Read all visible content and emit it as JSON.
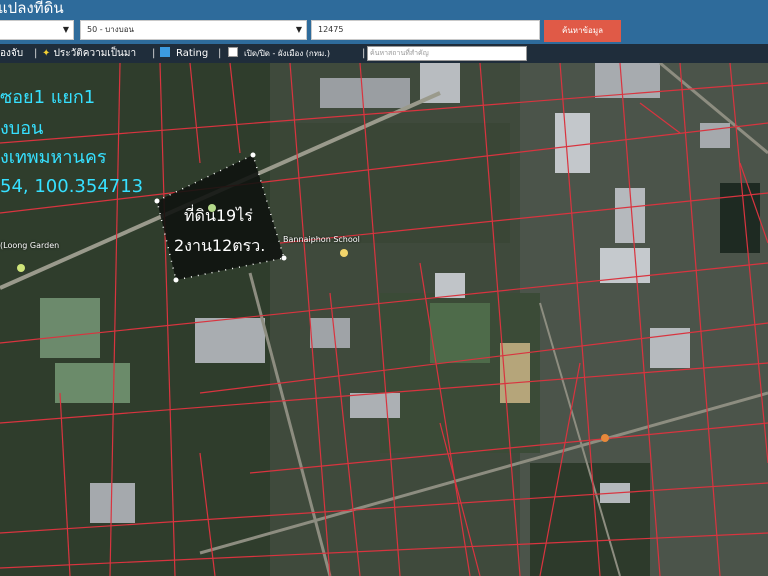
{
  "header": {
    "title": "แปลงที่ดิน",
    "province_value": "",
    "district_value": "50 - บางบอน",
    "parcel_number": "12475",
    "search_button": "ค้นหาข้อมูล"
  },
  "toolbar": {
    "item1": "องจับ",
    "history": "ประวัติความเป็นมา",
    "rating": "Rating",
    "toggle_label": "เปิด/ปิด - ผังเมือง (กทม.)",
    "place_search_placeholder": "ค้นหาสถานที่สำคัญ"
  },
  "overlay": {
    "line1": "ซอย1 แยก1",
    "line2": "งบอน",
    "line3": "งเทพมหานคร",
    "line4": "54, 100.354713"
  },
  "plot": {
    "area_line1": "ที่ดิน19ไร่",
    "area_line2": "2งาน12ตรว."
  },
  "map_labels": {
    "school": "Bannaiphon School",
    "garden": "(Loong Garden"
  },
  "colors": {
    "header_bg": "#2e6b9b",
    "toolbar_bg": "#1f2d3b",
    "search_button": "#e05a47",
    "overlay_text": "#36e0ff",
    "parcel_lines": "#d9343f"
  }
}
